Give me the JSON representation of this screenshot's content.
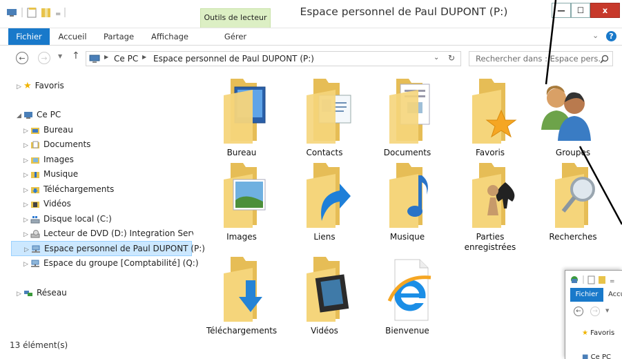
{
  "window": {
    "title": "Espace personnel de Paul DUPONT (P:)",
    "contextual_group": "Outils de lecteur",
    "minimize": "—",
    "maximize": "☐",
    "close": "x"
  },
  "ribbon": {
    "tabs": [
      {
        "label": "Fichier"
      },
      {
        "label": "Accueil"
      },
      {
        "label": "Partage"
      },
      {
        "label": "Affichage"
      },
      {
        "label": "Gérer"
      }
    ]
  },
  "address": {
    "crumbs": [
      "Ce PC",
      "Espace personnel de Paul DUPONT (P:)"
    ],
    "search_placeholder": "Rechercher dans : Espace pers..."
  },
  "nav": {
    "favorites": "Favoris",
    "this_pc": "Ce PC",
    "items": [
      "Bureau",
      "Documents",
      "Images",
      "Musique",
      "Téléchargements",
      "Vidéos",
      "Disque local (C:)",
      "Lecteur de DVD (D:) Integration Services",
      "Espace personnel de Paul DUPONT (P:)",
      "Espace du groupe [Comptabilité] (Q:)"
    ],
    "network": "Réseau"
  },
  "content": {
    "items": [
      {
        "label": "Bureau"
      },
      {
        "label": "Contacts"
      },
      {
        "label": "Documents"
      },
      {
        "label": "Favoris"
      },
      {
        "label": "Groupes"
      },
      {
        "label": "Images"
      },
      {
        "label": "Liens"
      },
      {
        "label": "Musique"
      },
      {
        "label": "Parties enregistrées"
      },
      {
        "label": "Recherches"
      },
      {
        "label": "Téléchargements"
      },
      {
        "label": "Vidéos"
      },
      {
        "label": "Bienvenue"
      }
    ]
  },
  "status": {
    "count": "13 élément(s)"
  },
  "overlay": {
    "tabs": [
      "Fichier",
      "Accu"
    ],
    "favorites": "Favoris",
    "this_pc": "Ce PC"
  },
  "colors": {
    "accent": "#1979ca",
    "selection": "#cce8ff",
    "folder": "#f5d57b",
    "contextual": "#dcefc4"
  }
}
